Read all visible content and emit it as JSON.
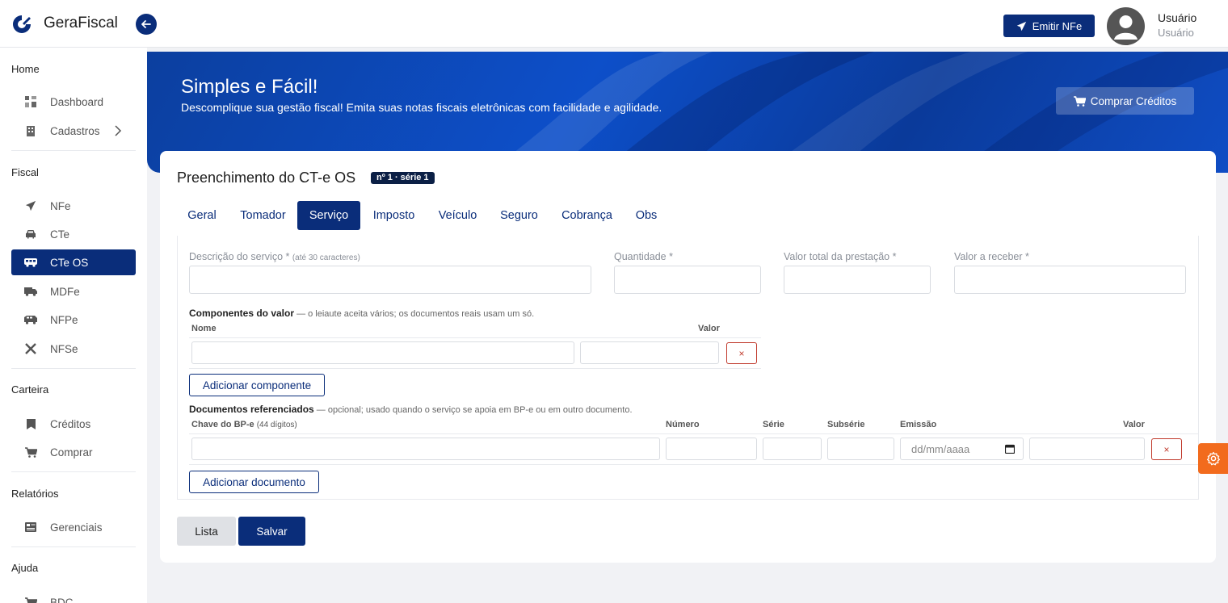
{
  "brand": {
    "name": "GeraFiscal"
  },
  "topbar": {
    "emit_label": "Emitir NFe",
    "user_name": "Usuário",
    "user_role": "Usuário"
  },
  "sidebar": {
    "sections": [
      {
        "title": "Home",
        "items": [
          {
            "label": "Dashboard",
            "icon": "grid-icon"
          },
          {
            "label": "Cadastros",
            "icon": "building-icon"
          }
        ]
      },
      {
        "title": "Fiscal",
        "items": [
          {
            "label": "NFe",
            "icon": "send-icon"
          },
          {
            "label": "CTe",
            "icon": "car-icon"
          },
          {
            "label": "CTe OS",
            "icon": "bus-icon"
          },
          {
            "label": "MDFe",
            "icon": "truck-icon"
          },
          {
            "label": "NFPe",
            "icon": "van-icon"
          },
          {
            "label": "NFSe",
            "icon": "tools-icon"
          }
        ]
      },
      {
        "title": "Carteira",
        "items": [
          {
            "label": "Créditos",
            "icon": "bookmark-icon"
          },
          {
            "label": "Comprar",
            "icon": "cart-icon"
          }
        ]
      },
      {
        "title": "Relatórios",
        "items": [
          {
            "label": "Gerenciais",
            "icon": "report-icon"
          }
        ]
      },
      {
        "title": "Ajuda",
        "items": [
          {
            "label": "BDC",
            "icon": "help-icon"
          }
        ]
      }
    ],
    "active_item": "CTe OS"
  },
  "banner": {
    "title": "Simples e Fácil!",
    "subtitle": "Descomplique sua gestão fiscal! Emita suas notas fiscais eletrônicas com facilidade e agilidade.",
    "buy_label": "Comprar Créditos"
  },
  "form": {
    "title": "Preenchimento do CT-e OS",
    "badge": "nº 1 · série 1",
    "tabs": [
      "Geral",
      "Tomador",
      "Serviço",
      "Imposto",
      "Veículo",
      "Seguro",
      "Cobrança",
      "Obs"
    ],
    "active_tab": "Serviço",
    "fields": {
      "descricao": {
        "label": "Descrição do serviço *",
        "hint": "(até 30 caracteres)",
        "value": ""
      },
      "quantidade": {
        "label": "Quantidade *",
        "value": ""
      },
      "valor_total": {
        "label": "Valor total da prestação *",
        "value": ""
      },
      "valor_receber": {
        "label": "Valor a receber *",
        "value": ""
      }
    },
    "componentes": {
      "title": "Componentes do valor",
      "note": " — o leiaute aceita vários; os documentos reais usam um só.",
      "columns": [
        "Nome",
        "Valor"
      ],
      "remove_label": "×",
      "add_label": "Adicionar componente"
    },
    "documentos": {
      "title": "Documentos referenciados",
      "note": " — opcional; usado quando o serviço se apoia em BP-e ou em outro documento.",
      "columns": {
        "chave": "Chave do BP-e",
        "chave_hint": "(44 dígitos)",
        "numero": "Número",
        "serie": "Série",
        "subserie": "Subsérie",
        "emissao": "Emissão",
        "valor": "Valor"
      },
      "date_placeholder": "dd/mm/aaaa",
      "remove_label": "×",
      "add_label": "Adicionar documento"
    },
    "actions": {
      "list_label": "Lista",
      "save_label": "Salvar"
    }
  },
  "colors": {
    "primary": "#0a2d7a",
    "danger": "#c0392b",
    "accent": "#f26b1d"
  }
}
